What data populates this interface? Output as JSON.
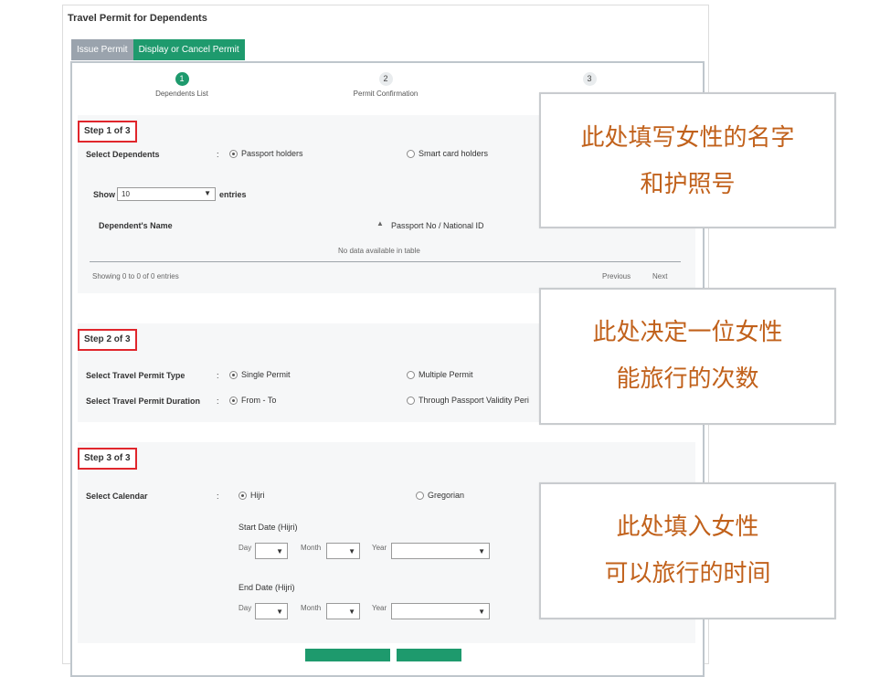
{
  "panel_title": "Travel Permit for Dependents",
  "tabs": {
    "issue": "Issue Permit",
    "display": "Display or Cancel Permit"
  },
  "wizard": [
    {
      "num": "1",
      "label": "Dependents List"
    },
    {
      "num": "2",
      "label": "Permit Confirmation"
    },
    {
      "num": "3",
      "label": ""
    }
  ],
  "step1": {
    "heading": "Step 1 of 3",
    "select_label": "Select Dependents",
    "colon": ":",
    "opt_passport": "Passport holders",
    "opt_smart": "Smart card holders",
    "show": "Show",
    "entries_value": "10",
    "entries": "entries",
    "col_name": "Dependent's Name",
    "col_sort": "▲",
    "col_passport": "Passport No / National ID",
    "no_data": "No data available in table",
    "showing": "Showing 0 to 0 of 0 entries",
    "previous": "Previous",
    "next": "Next"
  },
  "step2": {
    "heading": "Step 2 of 3",
    "type_label": "Select Travel Permit Type",
    "duration_label": "Select Travel Permit Duration",
    "colon": ":",
    "opt_single": "Single Permit",
    "opt_multiple": "Multiple Permit",
    "opt_fromto": "From - To",
    "opt_through": "Through Passport Validity Peri"
  },
  "step3": {
    "heading": "Step 3 of 3",
    "calendar_label": "Select Calendar",
    "colon": ":",
    "opt_hijri": "Hijri",
    "opt_gregorian": "Gregorian",
    "start_title": "Start Date (Hijri)",
    "end_title": "End Date (Hijri)",
    "day": "Day",
    "month": "Month",
    "year": "Year"
  },
  "notes": {
    "n1": [
      "此处填写女性的名字",
      "和护照号"
    ],
    "n2": [
      "此处决定一位女性",
      "能旅行的次数"
    ],
    "n3": [
      "此处填入女性",
      "可以旅行的时间"
    ]
  },
  "colors": {
    "accent": "#1e9a6d",
    "step_border": "#e0262c",
    "note_text": "#c1611b"
  }
}
